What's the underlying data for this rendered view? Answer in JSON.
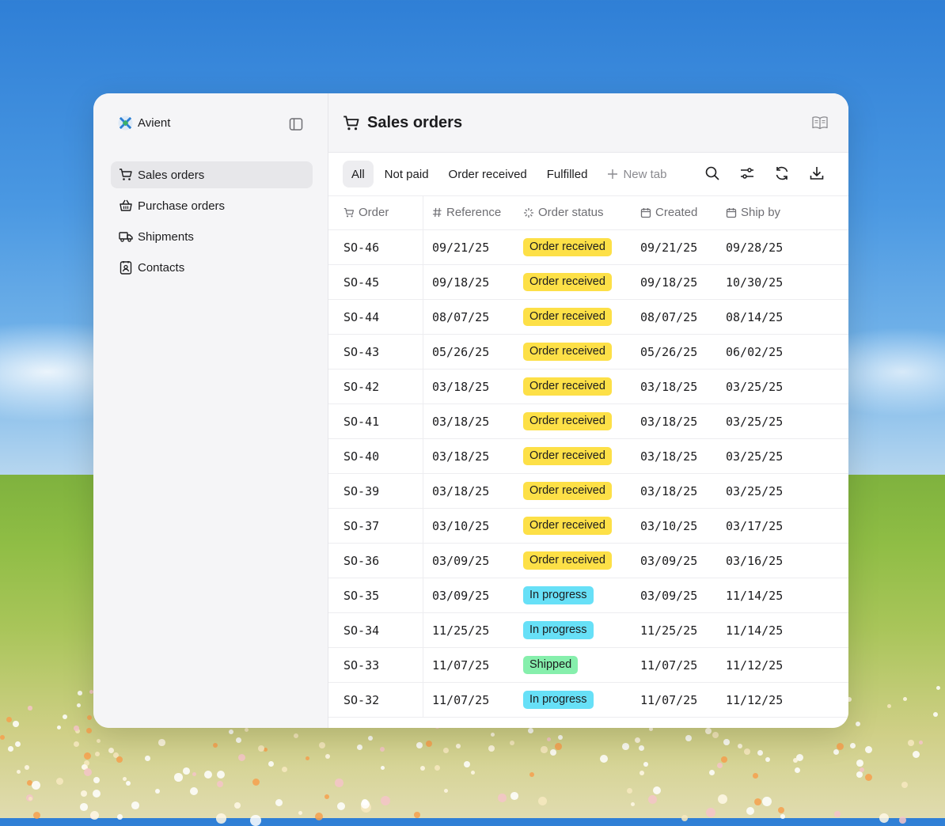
{
  "brand": {
    "name": "Avient"
  },
  "sidebar": {
    "items": [
      {
        "label": "Sales orders",
        "icon": "cart-icon",
        "active": true
      },
      {
        "label": "Purchase orders",
        "icon": "shopping-basket-icon",
        "active": false
      },
      {
        "label": "Shipments",
        "icon": "truck-icon",
        "active": false
      },
      {
        "label": "Contacts",
        "icon": "contact-card-icon",
        "active": false
      }
    ]
  },
  "header": {
    "title": "Sales orders",
    "icon": "cart-icon"
  },
  "tabs": [
    {
      "label": "All",
      "active": true
    },
    {
      "label": "Not paid",
      "active": false
    },
    {
      "label": "Order received",
      "active": false
    },
    {
      "label": "Fulfilled",
      "active": false
    }
  ],
  "new_tab_label": "New tab",
  "columns": {
    "order": "Order",
    "reference": "Reference",
    "status": "Order status",
    "created": "Created",
    "ship_by": "Ship by"
  },
  "rows": [
    {
      "order": "SO-46",
      "reference": "09/21/25",
      "status": "Order received",
      "created": "09/21/25",
      "ship_by": "09/28/25"
    },
    {
      "order": "SO-45",
      "reference": "09/18/25",
      "status": "Order received",
      "created": "09/18/25",
      "ship_by": "10/30/25"
    },
    {
      "order": "SO-44",
      "reference": "08/07/25",
      "status": "Order received",
      "created": "08/07/25",
      "ship_by": "08/14/25"
    },
    {
      "order": "SO-43",
      "reference": "05/26/25",
      "status": "Order received",
      "created": "05/26/25",
      "ship_by": "06/02/25"
    },
    {
      "order": "SO-42",
      "reference": "03/18/25",
      "status": "Order received",
      "created": "03/18/25",
      "ship_by": "03/25/25"
    },
    {
      "order": "SO-41",
      "reference": "03/18/25",
      "status": "Order received",
      "created": "03/18/25",
      "ship_by": "03/25/25"
    },
    {
      "order": "SO-40",
      "reference": "03/18/25",
      "status": "Order received",
      "created": "03/18/25",
      "ship_by": "03/25/25"
    },
    {
      "order": "SO-39",
      "reference": "03/18/25",
      "status": "Order received",
      "created": "03/18/25",
      "ship_by": "03/25/25"
    },
    {
      "order": "SO-37",
      "reference": "03/10/25",
      "status": "Order received",
      "created": "03/10/25",
      "ship_by": "03/17/25"
    },
    {
      "order": "SO-36",
      "reference": "03/09/25",
      "status": "Order received",
      "created": "03/09/25",
      "ship_by": "03/16/25"
    },
    {
      "order": "SO-35",
      "reference": "03/09/25",
      "status": "In progress",
      "created": "03/09/25",
      "ship_by": "11/14/25"
    },
    {
      "order": "SO-34",
      "reference": "11/25/25",
      "status": "In progress",
      "created": "11/25/25",
      "ship_by": "11/14/25"
    },
    {
      "order": "SO-33",
      "reference": "11/07/25",
      "status": "Shipped",
      "created": "11/07/25",
      "ship_by": "11/12/25"
    },
    {
      "order": "SO-32",
      "reference": "11/07/25",
      "status": "In progress",
      "created": "11/07/25",
      "ship_by": "11/12/25"
    }
  ],
  "status_colors": {
    "Order received": "#fde047",
    "In progress": "#67e0f7",
    "Shipped": "#86efac"
  }
}
